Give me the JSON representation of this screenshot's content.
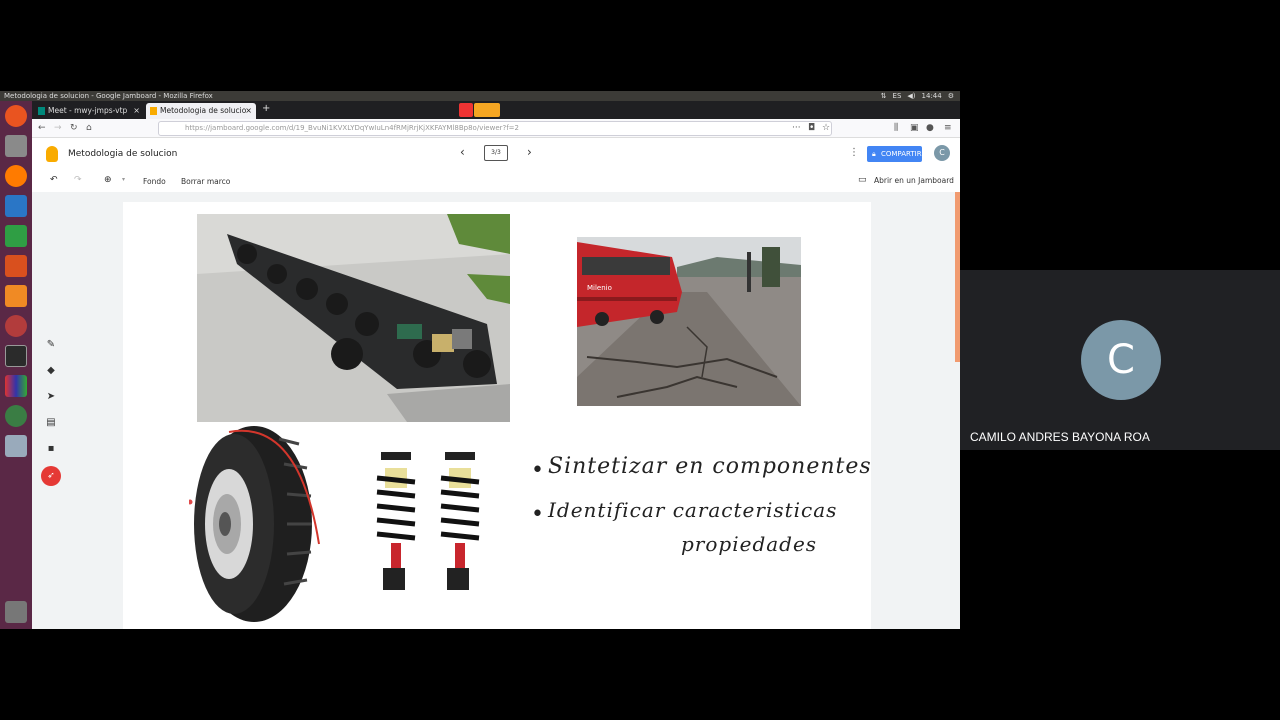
{
  "system": {
    "title": "Metodologia de solucion - Google Jamboard - Mozilla Firefox",
    "time": "14:44",
    "lang": "ES"
  },
  "tabs": [
    {
      "label": "Meet - mwy-jmps-vtp"
    },
    {
      "label": "Metodologia de solucio"
    }
  ],
  "nav": {
    "url": "https://jamboard.google.com/d/19_BvuNi1KVXLYDqYwIuLn4fRMjRrjKjXKFAYMl8Bp8o/viewer?f=2"
  },
  "jamboard": {
    "title": "Metodologia de solucion",
    "frame_counter": "3/3",
    "share_label": "COMPARTIR",
    "account_initial": "C",
    "toolbar": {
      "background_label": "Fondo",
      "clear_label": "Borrar marco",
      "open_label": "Abrir en un Jamboard"
    }
  },
  "board": {
    "bus_sign": "Milenio",
    "notes": [
      "Sintetizar en componentes",
      "Identificar caracteristicas",
      "propiedades"
    ]
  },
  "meet": {
    "participant_initial": "C",
    "participant_name": "CAMILO ANDRES BAYONA ROA"
  },
  "colors": {
    "launcher": "#5a2846",
    "share_button": "#4285f4",
    "avatar": "#7b98a8"
  }
}
